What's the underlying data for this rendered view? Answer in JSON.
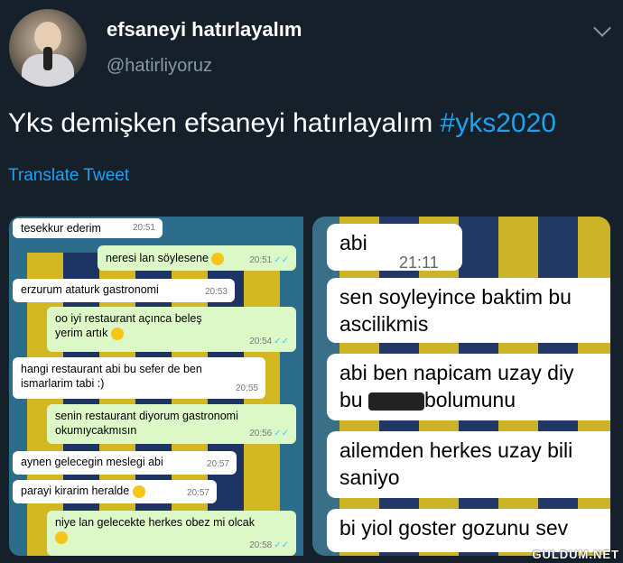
{
  "header": {
    "display_name": "efsaneyi hatırlayalım",
    "handle": "@hatirliyoruz"
  },
  "tweet": {
    "text": "Yks demişken efsaneyi hatırlayalım ",
    "hashtag": "#yks2020",
    "translate_label": "Translate Tweet"
  },
  "left_chat": [
    {
      "text": "tesekkur ederim",
      "time": "20:51",
      "dir": "in"
    },
    {
      "text": "neresi lan söylesene",
      "time": "20:51",
      "dir": "out"
    },
    {
      "text": "erzurum ataturk gastronomi",
      "time": "20:53",
      "dir": "in"
    },
    {
      "text": "oo iyi restaurant açınca beleş yerim artık",
      "time": "20:54",
      "dir": "out"
    },
    {
      "text": "hangi restaurant abi bu sefer de ben ismarlarim tabi :)",
      "time": "20:55",
      "dir": "in"
    },
    {
      "text": "senin restaurant diyorum gastronomi okumıycakmısın",
      "time": "20:56",
      "dir": "out"
    },
    {
      "text": "aynen gelecegin meslegi abi",
      "time": "20:57",
      "dir": "in"
    },
    {
      "text": "parayi kirarim heralde",
      "time": "20:57",
      "dir": "in"
    },
    {
      "text": "niye lan gelecekte herkes obez mi olcak",
      "time": "20:58",
      "dir": "out"
    }
  ],
  "right_chat": {
    "b1_text": "abi",
    "b1_time": "21:11",
    "b2_line1": "sen soyleyince baktim bu",
    "b2_line2": "ascilikmis",
    "b3_line1": "abi ben napicam uzay diy",
    "b3_line2a": "bu",
    "b3_line2b": "bolumunu",
    "b4_line1": "ailemden herkes uzay bili",
    "b4_line2": "saniyo",
    "b5_text": "bi yiol goster gozunu sev"
  },
  "watermark": "GULDUM.NET",
  "colors": {
    "background": "#15202b",
    "link": "#1da1f2",
    "incoming_bubble": "#ffffff",
    "outgoing_bubble": "#dcf8c6"
  }
}
